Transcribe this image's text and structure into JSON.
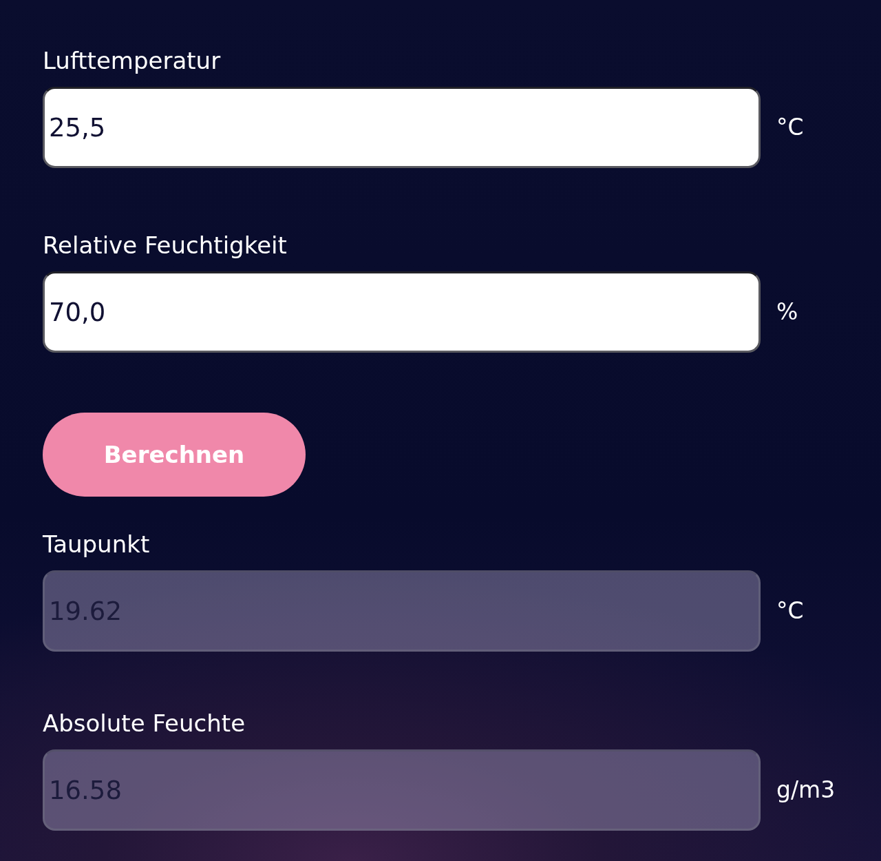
{
  "inputs": [
    {
      "label": "Lufttemperatur",
      "value": "25,5",
      "unit": "°C",
      "readonly": false
    },
    {
      "label": "Relative Feuchtigkeit",
      "value": "70,0",
      "unit": "%",
      "readonly": false
    }
  ],
  "button": {
    "label": "Berechnen"
  },
  "results": [
    {
      "label": "Taupunkt",
      "value": "19.62",
      "unit": "°C",
      "readonly": true
    },
    {
      "label": "Absolute Feuchte",
      "value": "16.58",
      "unit": "g/m3",
      "readonly": true
    }
  ]
}
